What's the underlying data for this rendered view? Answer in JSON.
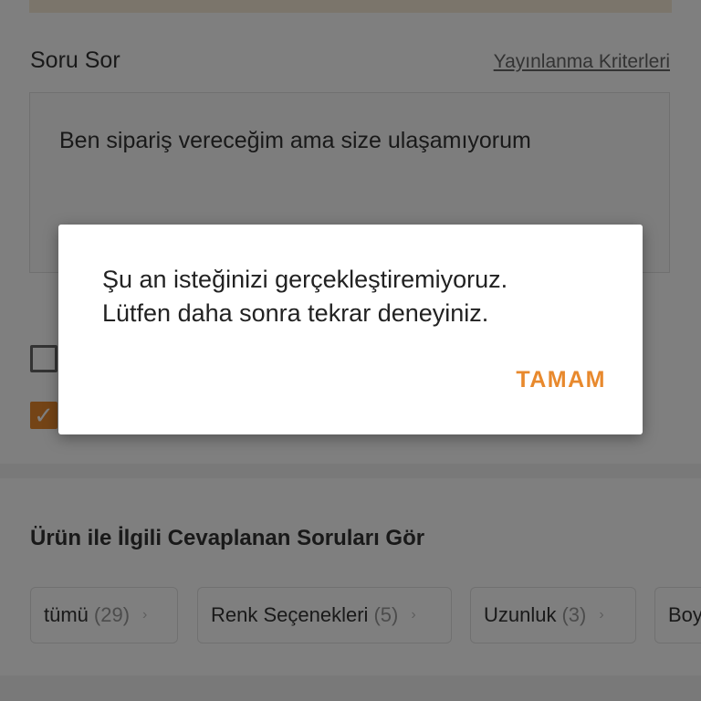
{
  "form": {
    "section_title": "Soru Sor",
    "criteria_link": "Yayınlanma Kriterleri",
    "question_value": "Ben sipariş vereceğim ama size ulaşamıyorum",
    "checkbox_2_checked": true
  },
  "answered": {
    "title": "Ürün ile İlgili Cevaplanan Soruları Gör",
    "chips": [
      {
        "label": "tümü",
        "count": "(29)"
      },
      {
        "label": "Renk Seçenekleri",
        "count": "(5)"
      },
      {
        "label": "Uzunluk",
        "count": "(3)"
      },
      {
        "label": "Boy",
        "count": ""
      }
    ]
  },
  "dialog": {
    "line1": "Şu an isteğinizi gerçekleştiremiyoruz.",
    "line2": "Lütfen daha sonra tekrar deneyiniz.",
    "ok_label": "TAMAM"
  },
  "colors": {
    "accent": "#e8892d",
    "overlay": "rgba(0,0,0,0.5)"
  },
  "icons": {
    "checkmark": "checkmark-icon",
    "chevron": "chevron-right-icon"
  }
}
